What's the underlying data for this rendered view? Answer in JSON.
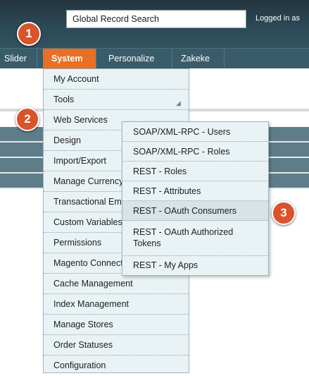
{
  "header": {
    "search_value": "Global Record Search",
    "logged_in": "Logged in as"
  },
  "nav": {
    "items": [
      "Slider",
      "System",
      "Personalize",
      "Zakeke"
    ],
    "active": "System"
  },
  "menu": {
    "items": [
      "My Account",
      "Tools",
      "Web Services",
      "Design",
      "Import/Export",
      "Manage Currency",
      "Transactional Emails",
      "Custom Variables",
      "Permissions",
      "Magento Connect",
      "Cache Management",
      "Index Management",
      "Manage Stores",
      "Order Statuses",
      "Configuration"
    ]
  },
  "submenu": {
    "items": [
      "SOAP/XML-RPC - Users",
      "SOAP/XML-RPC - Roles",
      "REST - Roles",
      "REST - Attributes",
      "REST - OAuth Consumers",
      "REST - OAuth Authorized Tokens",
      "REST - My Apps"
    ],
    "highlighted": "REST - OAuth Consumers"
  },
  "badges": [
    "1",
    "2",
    "3"
  ],
  "colors": {
    "header_bg": "#2d4a58",
    "active_tab": "#e86f24",
    "badge": "#d9532b",
    "menu_bg": "#e9f2f4"
  }
}
